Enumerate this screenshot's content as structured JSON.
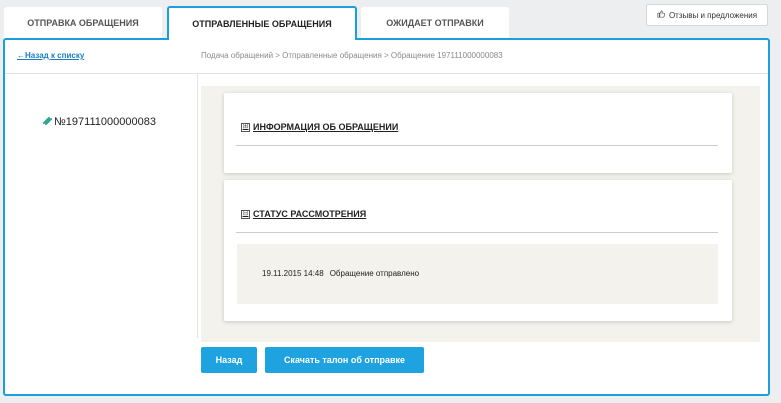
{
  "tabs": [
    {
      "label": "Отправка обращения"
    },
    {
      "label": "Отправленные обращения"
    },
    {
      "label": "Ожидает отправки"
    }
  ],
  "feedback": {
    "label": "Отзывы и предложения",
    "icon": "thumbs-up-icon"
  },
  "back_link": "Назад к списку",
  "breadcrumb": "Подача обращений > Отправленные обращения > Обращение 197111000000083",
  "appeal": {
    "number": "№197111000000083",
    "icon": "paperclip-icon"
  },
  "info_section": {
    "title": "ИНФОРМАЦИЯ ОБ ОБРАЩЕНИИ",
    "toggle": "⊞"
  },
  "status_section": {
    "title": "СТАТУС РАССМОТРЕНИЯ",
    "toggle": "⊟",
    "entries": [
      {
        "datetime": "19.11.2015 14:48",
        "text": "Обращение отправлено"
      }
    ]
  },
  "buttons": {
    "back": "Назад",
    "download": "Скачать талон об отправке"
  },
  "colors": {
    "accent": "#1a9fdc",
    "content_bg": "#f4f2ec"
  }
}
